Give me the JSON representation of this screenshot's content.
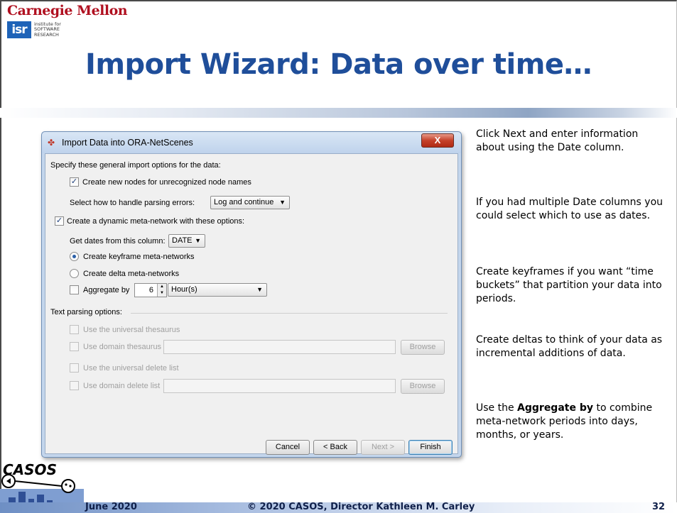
{
  "slide": {
    "logo_cmu": "Carnegie Mellon",
    "logo_isr_abbr": "isr",
    "logo_isr_lines": "institute for\nSOFTWARE\nRESEARCH",
    "title": "Import Wizard: Data over time…",
    "logo_casos": "CASOS",
    "colors": {
      "title": "#1f4e9a",
      "cmu_red": "#b01020",
      "isr_blue": "#1e63b8"
    }
  },
  "dialog": {
    "title": "Import Data into ORA-NetScenes",
    "close_label": "X",
    "general_heading": "Specify these general import options for the data:",
    "create_nodes_label": "Create new nodes for unrecognized node names",
    "create_nodes_checked": true,
    "parse_errors_label": "Select how to handle parsing errors:",
    "parse_errors_value": "Log and continue",
    "dynamic_label": "Create a dynamic meta-network with these options:",
    "dynamic_checked": true,
    "dates_column_label": "Get dates from this column:",
    "dates_column_value": "DATE",
    "keyframe_label": "Create keyframe meta-networks",
    "keyframe_selected": true,
    "delta_label": "Create delta meta-networks",
    "aggregate_label": "Aggregate by",
    "aggregate_checked": false,
    "aggregate_amount": "6",
    "aggregate_unit": "Hour(s)",
    "text_parsing_heading": "Text parsing options:",
    "universal_thesaurus_label": "Use the universal thesaurus",
    "domain_thesaurus_label": "Use domain thesaurus",
    "universal_delete_label": "Use the universal delete list",
    "domain_delete_label": "Use domain delete list",
    "browse_label": "Browse",
    "buttons": {
      "cancel": "Cancel",
      "back": "< Back",
      "next": "Next >",
      "finish": "Finish"
    }
  },
  "notes": [
    "Click Next and enter information about using the Date column.",
    "If you had multiple Date columns you could select which to use as dates.",
    "Create keyframes if you want “time buckets” that partition your data into periods.",
    "Create deltas to think of your data as incremental additions of data."
  ],
  "note_aggregate": {
    "prefix": "Use the ",
    "bold": "Aggregate by",
    "suffix": " to combine meta-network periods into days, months, or years."
  },
  "footer": {
    "date": "June 2020",
    "copyright": "© 2020 CASOS, Director Kathleen M. Carley",
    "page_number": "32"
  }
}
